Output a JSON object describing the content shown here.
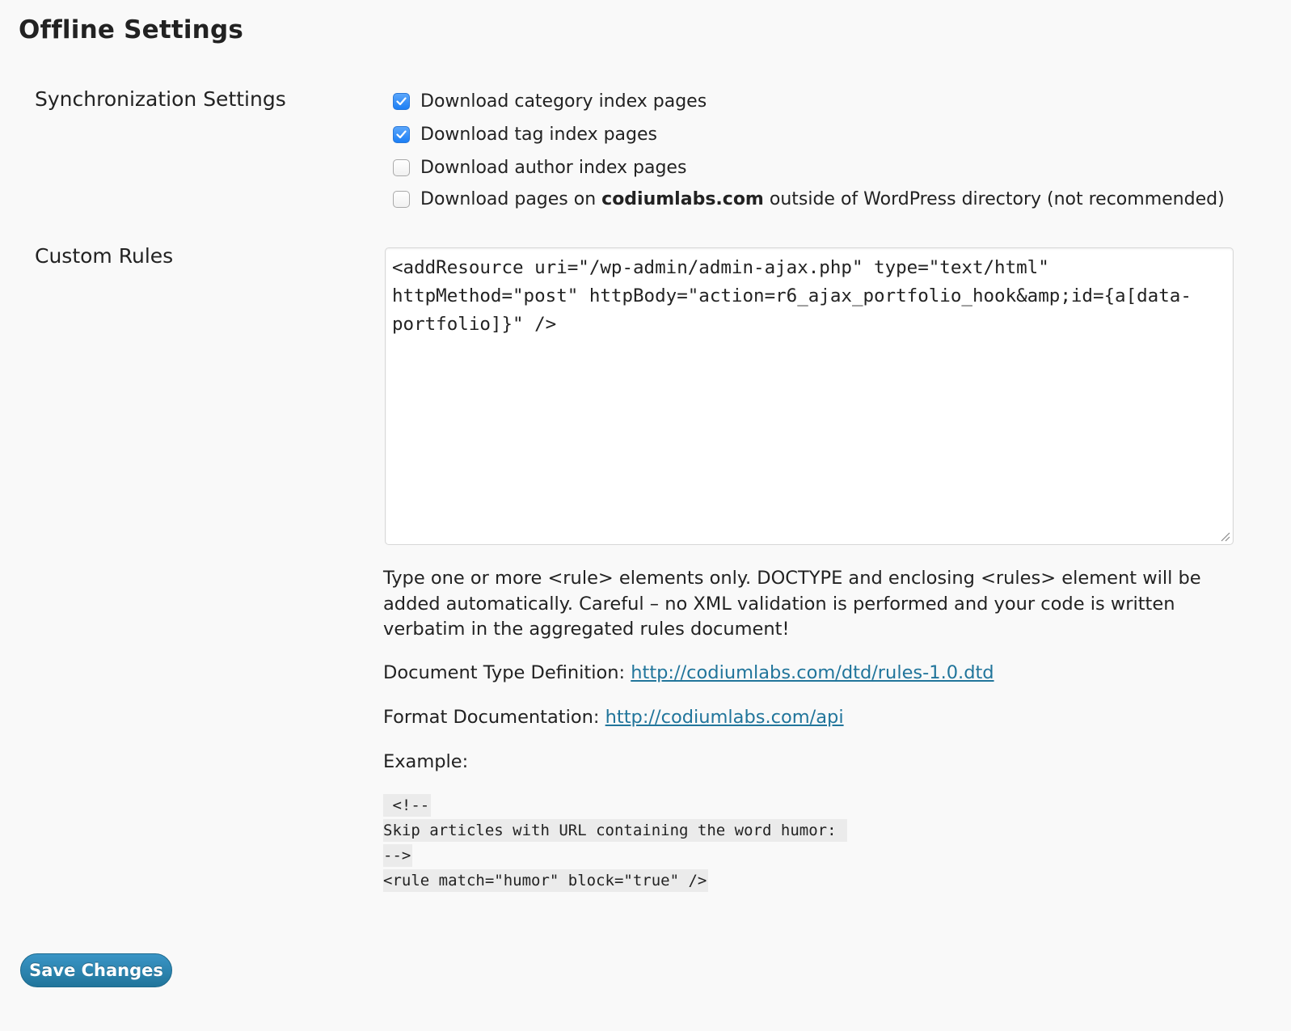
{
  "page": {
    "title": "Offline Settings"
  },
  "sync": {
    "label": "Synchronization Settings",
    "options": [
      {
        "label": "Download category index pages",
        "checked": true
      },
      {
        "label": "Download tag index pages",
        "checked": true
      },
      {
        "label": "Download author index pages",
        "checked": false
      },
      {
        "label_prefix": "Download pages on ",
        "label_bold": "codiumlabs.com",
        "label_suffix": " outside of WordPress directory (not recommended)",
        "checked": false
      }
    ]
  },
  "rules": {
    "label": "Custom Rules",
    "value": "<addResource uri=\"/wp-admin/admin-ajax.php\" type=\"text/html\" httpMethod=\"post\" httpBody=\"action=r6_ajax_portfolio_hook&amp;id={a[data-portfolio]}\" />",
    "help": "Type one or more <rule> elements only. DOCTYPE and enclosing <rules> element will be added automatically. Careful – no XML validation is performed and your code is written verbatim in the aggregated rules document!",
    "dtd_label": "Document Type Definition: ",
    "dtd_link": "http://codiumlabs.com/dtd/rules-1.0.dtd",
    "format_label": "Format Documentation: ",
    "format_link": "http://codiumlabs.com/api",
    "example_label": "Example:",
    "example_lines": [
      " <!--",
      "Skip articles with URL containing the word humor: ",
      "-->",
      "<rule match=\"humor\" block=\"true\" />"
    ]
  },
  "actions": {
    "save_label": "Save Changes"
  },
  "colors": {
    "background": "#f9f9f9",
    "link": "#21759b",
    "button": "#21759b",
    "checkbox_checked": "#1b7ff5"
  }
}
